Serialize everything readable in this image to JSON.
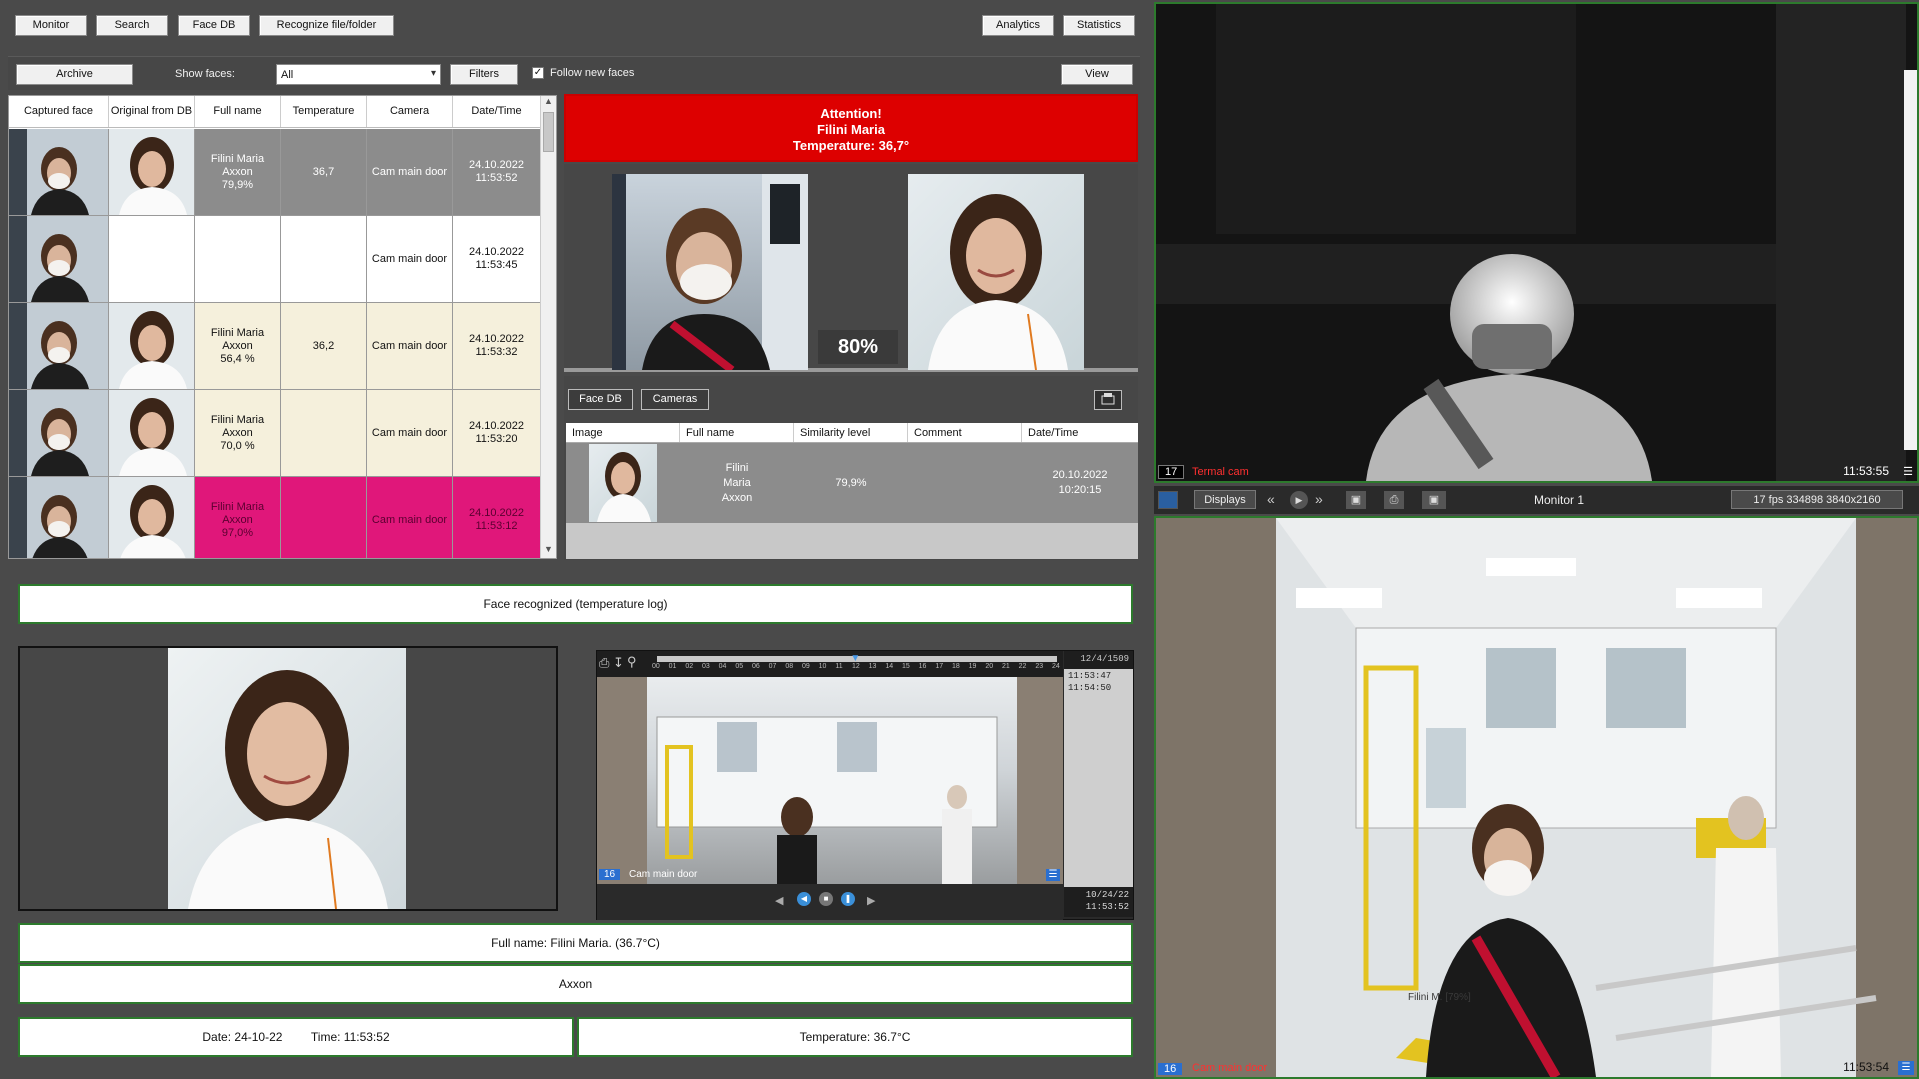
{
  "toolbar": {
    "monitor": "Monitor",
    "search": "Search",
    "face_db": "Face DB",
    "recognize": "Recognize file/folder",
    "analytics": "Analytics",
    "statistics": "Statistics"
  },
  "filterbar": {
    "archive": "Archive",
    "show_faces_label": "Show faces:",
    "show_faces_value": "All",
    "filters": "Filters",
    "follow_new_faces": "Follow new faces",
    "view": "View"
  },
  "table": {
    "headers": [
      "Captured face",
      "Original from DB",
      "Full name",
      "Temperature",
      "Camera",
      "Date/Time"
    ],
    "rows": [
      {
        "name": "Filini Maria\nAxxon\n79,9%",
        "temp": "36,7",
        "camera": "Cam main door",
        "datetime": "24.10.2022\n11:53:52",
        "bg": "#8c8c8c",
        "fg": "#ffffff"
      },
      {
        "name": "",
        "temp": "",
        "camera": "Cam main door",
        "datetime": "24.10.2022\n11:53:45",
        "bg": "#ffffff",
        "fg": "#111111"
      },
      {
        "name": "Filini Maria\nAxxon\n56,4 %",
        "temp": "36,2",
        "camera": "Cam main door",
        "datetime": "24.10.2022\n11:53:32",
        "bg": "#f5f0dc",
        "fg": "#111111"
      },
      {
        "name": "Filini Maria\nAxxon\n70,0 %",
        "temp": "",
        "camera": "Cam main door",
        "datetime": "24.10.2022\n11:53:20",
        "bg": "#f5f0dc",
        "fg": "#111111"
      },
      {
        "name": "Filini Maria\nAxxon\n97,0%",
        "temp": "",
        "camera": "Cam main door",
        "datetime": "24.10.2022\n11:53:12",
        "bg": "#e0177a",
        "fg": "#5a0030"
      }
    ]
  },
  "alert": {
    "text": "Attention!\nFilini Maria\nTemperature: 36,7°",
    "color": "#dd0000"
  },
  "match": {
    "similarity": "80%"
  },
  "result_tabs": {
    "face_db": "Face DB",
    "cameras": "Cameras"
  },
  "result_table": {
    "headers": [
      "Image",
      "Full name",
      "Similarity level",
      "Comment",
      "Date/Time"
    ],
    "row": {
      "name": "Filini\nMaria\nAxxon",
      "similarity": "79,9%",
      "comment": "",
      "datetime": "20.10.2022\n10:20:15"
    }
  },
  "face_recognized_log": "Face recognized (temperature log)",
  "player": {
    "timeline_ticks": [
      "00",
      "01",
      "02",
      "03",
      "04",
      "05",
      "06",
      "07",
      "08",
      "09",
      "10",
      "11",
      "12",
      "13",
      "14",
      "15",
      "16",
      "17",
      "18",
      "19",
      "20",
      "21",
      "22",
      "23",
      "24"
    ],
    "date_top": "12/4/1509",
    "time_1": "11:53:47",
    "time_2": "11:54:50",
    "cam_num": "16",
    "cam_name": "Cam main door",
    "date_bottom": "10/24/22",
    "time_bottom": "11:53:52"
  },
  "info": {
    "full_name": "Full name: Filini Maria. (36.7°C)",
    "org": "Axxon",
    "date": "Date: 24-10-22",
    "time": "Time: 11:53:52",
    "temperature": "Temperature: 36.7°C"
  },
  "thermal_cam": {
    "num": "17",
    "name": "Termal cam",
    "time": "11:53:55"
  },
  "monitor_bar": {
    "displays": "Displays",
    "monitor": "Monitor 1",
    "fps": "17 fps 334898 3840x2160"
  },
  "main_cam": {
    "num": "16",
    "name": "Cam main door",
    "time": "11:53:54",
    "overlay_label": "Filini M. [79%]"
  },
  "colors": {
    "accent_green": "#2d7a2d",
    "alert_red": "#dd0000",
    "highlight_pink": "#e0177a",
    "cam_label_red": "#ff3030"
  },
  "icons": [
    "chevron-down-icon",
    "print-icon",
    "lock-icon",
    "rewind-icon",
    "play-icon",
    "forward-icon",
    "menu-icon",
    "search-icon",
    "download-icon"
  ]
}
